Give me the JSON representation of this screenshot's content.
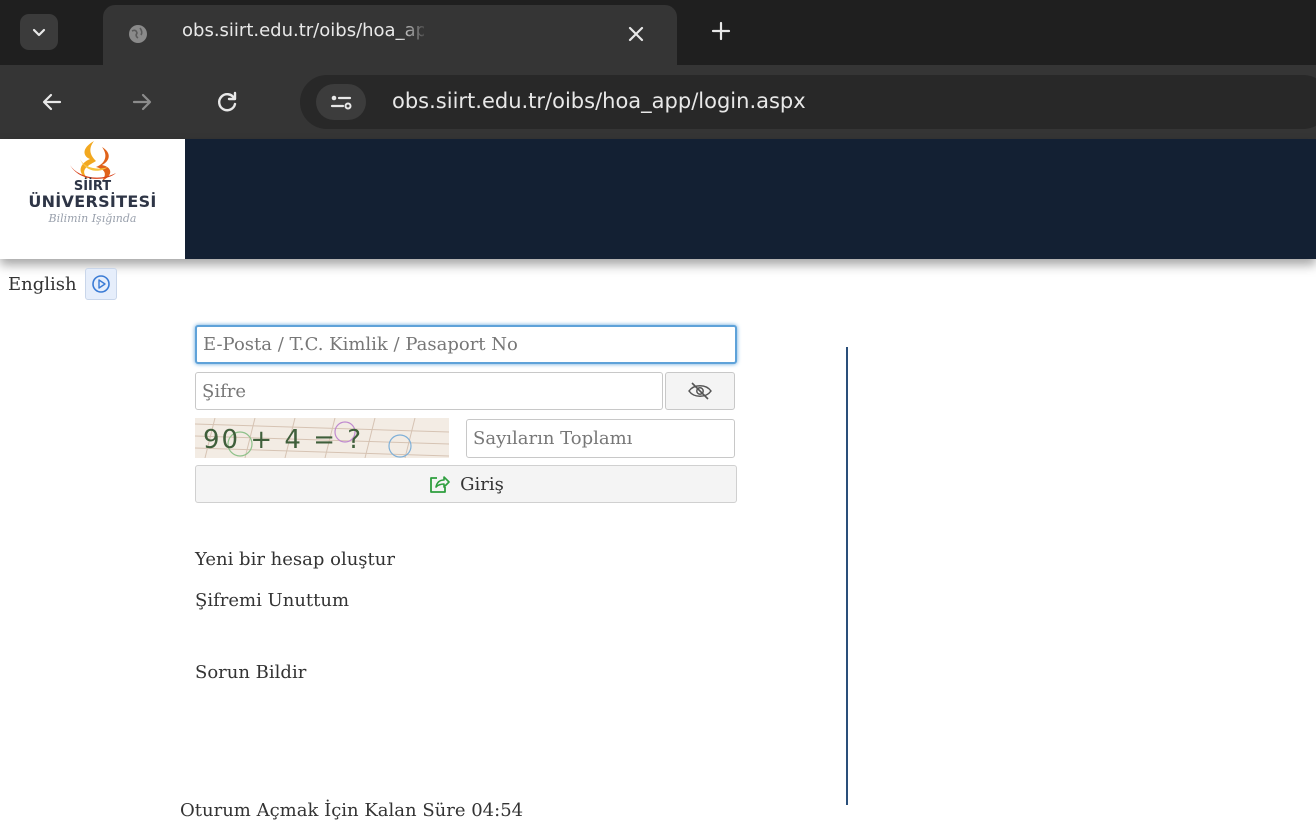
{
  "browser": {
    "tab_title": "obs.siirt.edu.tr/oibs/hoa_app/login.aspx",
    "url": "obs.siirt.edu.tr/oibs/hoa_app/login.aspx"
  },
  "header": {
    "logo_line1": "SİİRT",
    "logo_line2": "ÜNİVERSİTESİ",
    "logo_motto": "Bilimin Işığında"
  },
  "language": {
    "label": "English"
  },
  "login": {
    "email_placeholder": "E-Posta / T.C. Kimlik / Pasaport No",
    "password_placeholder": "Şifre",
    "captcha_text": "90 + 4 = ?",
    "captcha_placeholder": "Sayıların Toplamı",
    "submit_label": "Giriş"
  },
  "links": {
    "new_account": "Yeni bir hesap oluştur",
    "forgot_password": "Şifremi Unuttum",
    "report_issue": "Sorun Bildir"
  },
  "session": {
    "timer_text": "Oturum Açmak İçin Kalan Süre 04:54"
  },
  "colors": {
    "header_bg": "#132033",
    "focus_border": "#5ea2d9",
    "divider": "#2a4f7a",
    "chrome_dark": "#1f1f1f",
    "chrome_toolbar": "#353535"
  },
  "icons": {
    "tab_search": "chevron-down-icon",
    "tab_favicon": "globe-icon",
    "tab_close": "close-icon",
    "new_tab": "plus-icon",
    "back": "arrow-left-icon",
    "forward": "arrow-right-icon",
    "reload": "reload-icon",
    "site_info": "tune-icon",
    "language": "play-circle-icon",
    "password_toggle": "eye-slash-icon",
    "login": "share-square-icon"
  }
}
